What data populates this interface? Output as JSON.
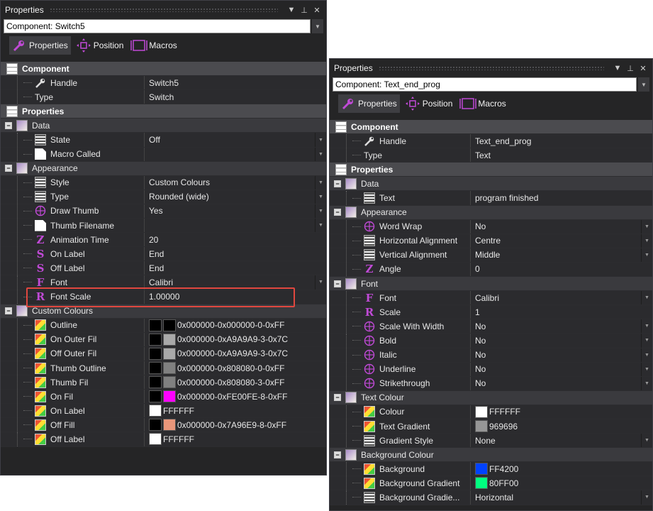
{
  "left": {
    "title": "Properties",
    "component_select": "Component: Switch5",
    "tabs": [
      "Properties",
      "Position",
      "Macros"
    ],
    "rows": [
      {
        "kind": "sec",
        "label": "Component",
        "icon": "stack-icon"
      },
      {
        "kind": "prop",
        "label": "Handle",
        "value": "Switch5",
        "icon": "wrench-icon"
      },
      {
        "kind": "prop",
        "label": "Type",
        "value": "Switch",
        "icon": ""
      },
      {
        "kind": "sec",
        "label": "Properties",
        "icon": "stack-icon"
      },
      {
        "kind": "sub",
        "label": "Data",
        "icon": "folder-icon"
      },
      {
        "kind": "prop",
        "label": "State",
        "value": "Off",
        "icon": "list-icon",
        "dd": true
      },
      {
        "kind": "prop",
        "label": "Macro Called",
        "value": "",
        "icon": "doc-icon",
        "dd": true
      },
      {
        "kind": "sub",
        "label": "Appearance",
        "icon": "folder-icon"
      },
      {
        "kind": "prop",
        "label": "Style",
        "value": "Custom Colours",
        "icon": "list-icon",
        "dd": true
      },
      {
        "kind": "prop",
        "label": "Type",
        "value": "Rounded (wide)",
        "icon": "list-icon",
        "dd": true
      },
      {
        "kind": "prop",
        "label": "Draw Thumb",
        "value": "Yes",
        "icon": "circle-plus-icon",
        "dd": true
      },
      {
        "kind": "prop",
        "label": "Thumb Filename",
        "value": "",
        "icon": "doc-icon",
        "dd": true
      },
      {
        "kind": "prop",
        "label": "Animation Time",
        "value": "20",
        "icon": "z-icon"
      },
      {
        "kind": "prop",
        "label": "On Label",
        "value": "End",
        "icon": "s-icon"
      },
      {
        "kind": "prop",
        "label": "Off Label",
        "value": "End",
        "icon": "s-icon"
      },
      {
        "kind": "prop",
        "label": "Font",
        "value": "Calibri",
        "icon": "font-icon",
        "dd": true
      },
      {
        "kind": "prop",
        "label": "Font Scale",
        "value": "1.00000",
        "icon": "r-icon"
      },
      {
        "kind": "sub",
        "label": "Custom Colours",
        "icon": "folder-icon"
      },
      {
        "kind": "prop",
        "label": "Outline",
        "value": "0x000000-0x000000-0-0xFF",
        "icon": "img-icon",
        "sw": [
          "#000000",
          "#000000"
        ]
      },
      {
        "kind": "prop",
        "label": "On Outer Fil",
        "value": "0x000000-0xA9A9A9-3-0x7C",
        "icon": "img-icon",
        "sw": [
          "#000000",
          "#a9a9a9"
        ]
      },
      {
        "kind": "prop",
        "label": "Off Outer Fil",
        "value": "0x000000-0xA9A9A9-3-0x7C",
        "icon": "img-icon",
        "sw": [
          "#000000",
          "#a9a9a9"
        ]
      },
      {
        "kind": "prop",
        "label": "Thumb Outline",
        "value": "0x000000-0x808080-0-0xFF",
        "icon": "img-icon",
        "sw": [
          "#000000",
          "#808080"
        ]
      },
      {
        "kind": "prop",
        "label": "Thumb Fil",
        "value": "0x000000-0x808080-3-0xFF",
        "icon": "img-icon",
        "sw": [
          "#000000",
          "#808080"
        ]
      },
      {
        "kind": "prop",
        "label": "On Fil",
        "value": "0x000000-0xFE00FE-8-0xFF",
        "icon": "img-icon",
        "sw": [
          "#000000",
          "#fe00fe"
        ]
      },
      {
        "kind": "prop",
        "label": "On Label",
        "value": "FFFFFF",
        "icon": "img-icon",
        "sw": [
          "#ffffff"
        ]
      },
      {
        "kind": "prop",
        "label": "Off Fill",
        "value": "0x000000-0x7A96E9-8-0xFF",
        "icon": "img-icon",
        "sw": [
          "#000000",
          "#e9967a"
        ]
      },
      {
        "kind": "prop",
        "label": "Off Label",
        "value": "FFFFFF",
        "icon": "img-icon",
        "sw": [
          "#ffffff"
        ]
      }
    ]
  },
  "right": {
    "title": "Properties",
    "component_select": "Component: Text_end_prog",
    "tabs": [
      "Properties",
      "Position",
      "Macros"
    ],
    "rows": [
      {
        "kind": "sec",
        "label": "Component",
        "icon": "stack-icon"
      },
      {
        "kind": "prop",
        "label": "Handle",
        "value": "Text_end_prog",
        "icon": "wrench-icon"
      },
      {
        "kind": "prop",
        "label": "Type",
        "value": "Text",
        "icon": ""
      },
      {
        "kind": "sec",
        "label": "Properties",
        "icon": "stack-icon"
      },
      {
        "kind": "sub",
        "label": "Data",
        "icon": "folder-icon"
      },
      {
        "kind": "prop",
        "label": "Text",
        "value": "program finished",
        "icon": "list-icon"
      },
      {
        "kind": "sub",
        "label": "Appearance",
        "icon": "folder-icon"
      },
      {
        "kind": "prop",
        "label": "Word Wrap",
        "value": "No",
        "icon": "circle-plus-icon",
        "dd": true
      },
      {
        "kind": "prop",
        "label": "Horizontal Alignment",
        "value": "Centre",
        "icon": "list-icon",
        "dd": true
      },
      {
        "kind": "prop",
        "label": "Vertical Alignment",
        "value": "Middle",
        "icon": "list-icon",
        "dd": true
      },
      {
        "kind": "prop",
        "label": "Angle",
        "value": "0",
        "icon": "z-icon"
      },
      {
        "kind": "sub",
        "label": "Font",
        "icon": "folder-icon"
      },
      {
        "kind": "prop",
        "label": "Font",
        "value": "Calibri",
        "icon": "font-icon",
        "dd": true
      },
      {
        "kind": "prop",
        "label": "Scale",
        "value": "1",
        "icon": "r-icon"
      },
      {
        "kind": "prop",
        "label": "Scale With Width",
        "value": "No",
        "icon": "circle-plus-icon",
        "dd": true
      },
      {
        "kind": "prop",
        "label": "Bold",
        "value": "No",
        "icon": "circle-plus-icon",
        "dd": true
      },
      {
        "kind": "prop",
        "label": "Italic",
        "value": "No",
        "icon": "circle-plus-icon",
        "dd": true
      },
      {
        "kind": "prop",
        "label": "Underline",
        "value": "No",
        "icon": "circle-plus-icon",
        "dd": true
      },
      {
        "kind": "prop",
        "label": "Strikethrough",
        "value": "No",
        "icon": "circle-plus-icon",
        "dd": true
      },
      {
        "kind": "sub",
        "label": "Text Colour",
        "icon": "folder-icon"
      },
      {
        "kind": "prop",
        "label": "Colour",
        "value": "FFFFFF",
        "icon": "img-icon",
        "sw": [
          "#ffffff"
        ]
      },
      {
        "kind": "prop",
        "label": "Text Gradient",
        "value": "969696",
        "icon": "img-icon",
        "sw": [
          "#969696"
        ]
      },
      {
        "kind": "prop",
        "label": "Gradient Style",
        "value": "None",
        "icon": "list-icon",
        "dd": true
      },
      {
        "kind": "sub",
        "label": "Background Colour",
        "icon": "folder-icon"
      },
      {
        "kind": "prop",
        "label": "Background",
        "value": "FF4200",
        "icon": "img-icon",
        "sw": [
          "#0042ff"
        ]
      },
      {
        "kind": "prop",
        "label": "Background Gradient",
        "value": "80FF00",
        "icon": "img-icon",
        "sw": [
          "#00ff80"
        ]
      },
      {
        "kind": "prop",
        "label": "Background Gradie...",
        "value": "Horizontal",
        "icon": "list-icon",
        "dd": true
      }
    ]
  },
  "colors": {
    "accent": "#c04ad6",
    "highlight": "#e0473f"
  }
}
